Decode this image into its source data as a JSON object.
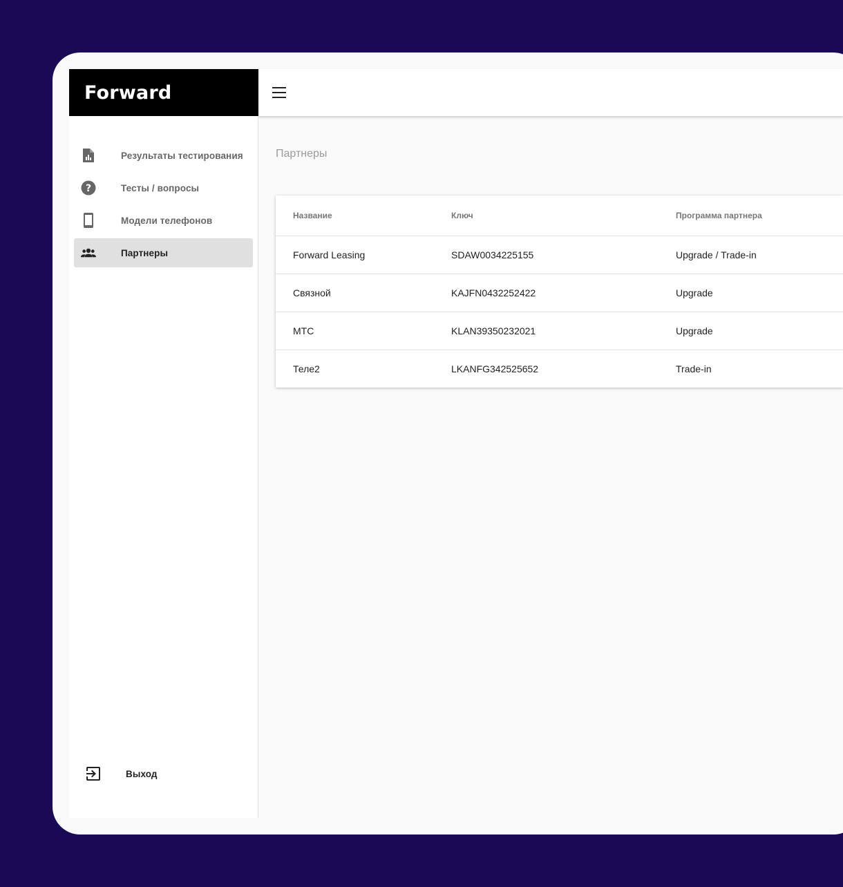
{
  "brand": {
    "name": "Forward"
  },
  "sidebar": {
    "items": [
      {
        "label": "Результаты тестирования",
        "icon": "report-file-icon",
        "active": false
      },
      {
        "label": "Тесты / вопросы",
        "icon": "help-circle-icon",
        "active": false
      },
      {
        "label": "Модели телефонов",
        "icon": "smartphone-icon",
        "active": false
      },
      {
        "label": "Партнеры",
        "icon": "group-icon",
        "active": true
      }
    ],
    "exit": {
      "label": "Выход",
      "icon": "exit-icon"
    }
  },
  "main": {
    "title": "Партнеры",
    "table": {
      "columns": [
        "Название",
        "Ключ",
        "Программа партнера"
      ],
      "rows": [
        [
          "Forward Leasing",
          "SDAW0034225155",
          "Upgrade / Trade-in"
        ],
        [
          "Связной",
          "KAJFN0432252422",
          "Upgrade"
        ],
        [
          "МТС",
          "KLAN39350232021",
          "Upgrade"
        ],
        [
          "Теле2",
          "LKANFG342525652",
          "Trade-in"
        ]
      ]
    }
  },
  "colors": {
    "background": "#1a0a55",
    "logo_bar": "#000000",
    "active_item": "#e0e0e0"
  }
}
